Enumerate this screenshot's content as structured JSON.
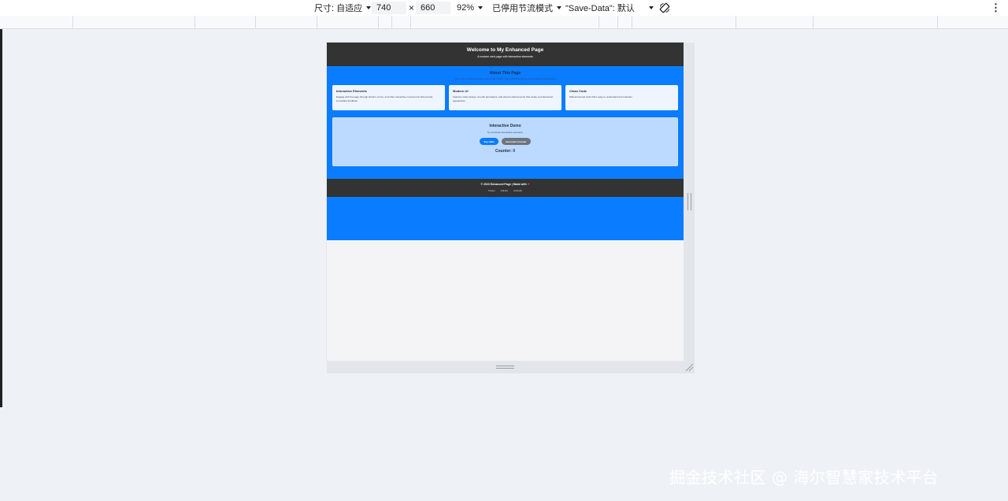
{
  "devtools": {
    "dimensions_label": "尺寸: 自适应",
    "width_value": "740",
    "times_symbol": "×",
    "height_value": "660",
    "zoom": "92%",
    "throttle": "已停用节流模式",
    "save_data": "\"Save-Data\": 默认",
    "more_glyph": "⋮"
  },
  "page": {
    "header": {
      "title": "Welcome to My Enhanced Page",
      "subtitle": "A modern web page with interactive elements"
    },
    "about": {
      "title": "About This Page",
      "description": "This is an enhanced version of a simple HTML page with CSS styling and JavaScript interactivity."
    },
    "cards": [
      {
        "title": "Interactive Elements",
        "text": "Engage with the page through buttons, forms, and other interactive components that provide immediate feedback."
      },
      {
        "title": "Modern UI",
        "text": "Features clean design, smooth animations, and visual enhancements that create a professional appearance."
      },
      {
        "title": "Clean Code",
        "text": "Well-structured code that's easy to understand and maintain."
      }
    ],
    "demo": {
      "title": "Interactive Demo",
      "subtitle": "Try out these interactive elements:",
      "say_hello": "Say Hello",
      "increment": "Increment Counter",
      "counter": "Counter: 0"
    },
    "footer": {
      "copyright": "© 2023 Enhanced Page | Made with",
      "heart": "❤",
      "links": [
        "Twitter",
        "GitHub",
        "LinkedIn"
      ]
    }
  },
  "watermark": "掘金技术社区 @ 海尔智慧家技术平台"
}
